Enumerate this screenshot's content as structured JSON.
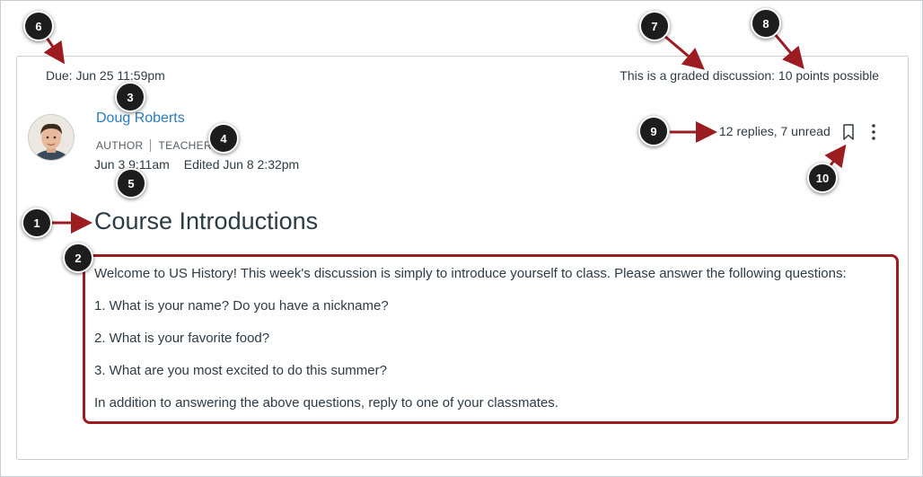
{
  "discussion": {
    "due": "Due: Jun 25 11:59pm",
    "graded_notice": "This is a graded discussion: 10 points possible",
    "author": {
      "name": "Doug Roberts",
      "role_author": "AUTHOR",
      "role_teacher": "TEACHER",
      "posted": "Jun 3 9:11am",
      "edited": "Edited Jun 8 2:32pm"
    },
    "replies_summary": "12 replies, 7 unread",
    "title": "Course Introductions",
    "message": [
      "Welcome to US History! This week's discussion is simply to introduce yourself to class. Please answer the following questions:",
      "1. What is your name? Do you have a nickname?",
      "2. What is your favorite food?",
      "3. What are you most excited to do this summer?",
      "In addition to answering the above questions, reply to one of your classmates."
    ]
  },
  "icons": {
    "bookmark": "bookmark-icon",
    "more": "kebab-menu-icon"
  },
  "callouts": [
    "1",
    "2",
    "3",
    "4",
    "5",
    "6",
    "7",
    "8",
    "9",
    "10"
  ],
  "colors": {
    "link": "#2b7abc",
    "text": "#2d3b45",
    "annotation": "#9b1c21",
    "callout_bg": "#1d1d1d"
  }
}
